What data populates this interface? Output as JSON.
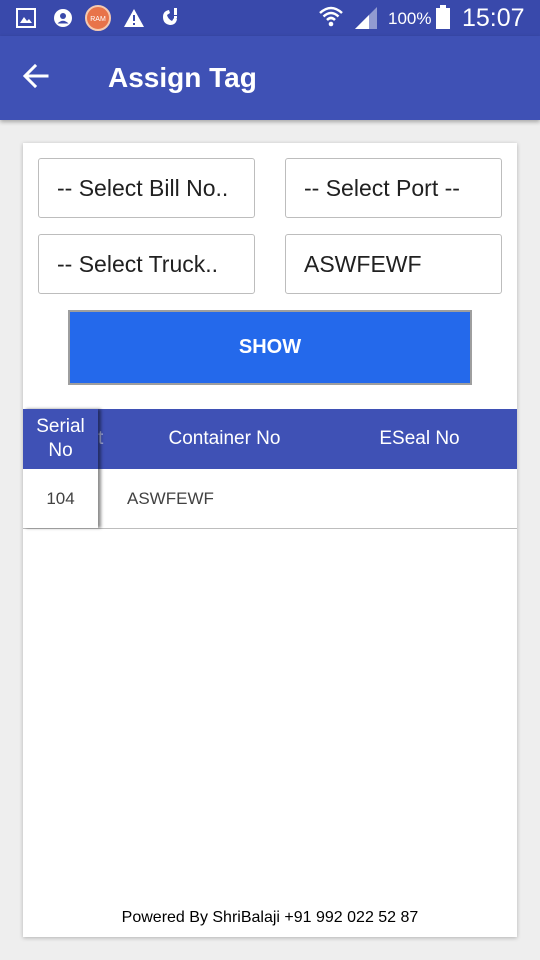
{
  "status_bar": {
    "battery": "100%",
    "time": "15:07",
    "icons": [
      "gallery-icon",
      "account-icon",
      "ram-icon",
      "warning-icon",
      "missed-call-icon",
      "wifi-icon",
      "signal-icon",
      "battery-icon"
    ],
    "ram_label": "RAM"
  },
  "app_bar": {
    "title": "Assign Tag",
    "back_icon": "arrow-back-icon",
    "color": "#3f51b5"
  },
  "form": {
    "bill_select": "-- Select Bill No..",
    "port_select": "-- Select Port --",
    "truck_select": "-- Select Truck..",
    "container_value": "ASWFEWF",
    "show_button": "SHOW",
    "button_color": "#2469eb"
  },
  "table": {
    "columns": [
      "Serial No",
      "Container No",
      "ESeal No"
    ],
    "hidden_column_fragment": "t",
    "rows": [
      {
        "serial": "104",
        "container": "ASWFEWF",
        "eseal": ""
      }
    ],
    "header_color": "#3f51b5"
  },
  "footer": {
    "text": "Powered By ShriBalaji +91 992 022 52 87"
  }
}
